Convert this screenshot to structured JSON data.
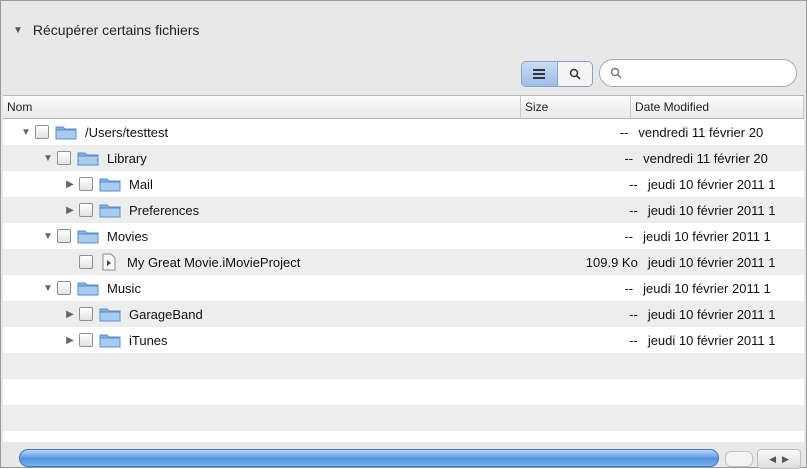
{
  "panel": {
    "title": "Récupérer certains fichiers",
    "title_icon": "disclosure-triangle-down-icon"
  },
  "toolbar": {
    "view_list_icon": "list-view-icon",
    "view_search_icon": "magnifier-icon",
    "search_placeholder": "",
    "search_icon": "magnifier-icon"
  },
  "table": {
    "columns": [
      "Nom",
      "Size",
      "Date Modified"
    ],
    "rows": [
      {
        "name": "/Users/testtest",
        "size": "--",
        "date": "vendredi 11 février 20",
        "level": 0,
        "disclosure": "open",
        "kind": "folder"
      },
      {
        "name": "Library",
        "size": "--",
        "date": "vendredi 11 février 20",
        "level": 1,
        "disclosure": "open",
        "kind": "folder"
      },
      {
        "name": "Mail",
        "size": "--",
        "date": "jeudi 10 février 2011 1",
        "level": 2,
        "disclosure": "closed",
        "kind": "folder"
      },
      {
        "name": "Preferences",
        "size": "--",
        "date": "jeudi 10 février 2011 1",
        "level": 2,
        "disclosure": "closed",
        "kind": "folder"
      },
      {
        "name": "Movies",
        "size": "--",
        "date": "jeudi 10 février 2011 1",
        "level": 1,
        "disclosure": "open",
        "kind": "folder"
      },
      {
        "name": "My Great Movie.iMovieProject",
        "size": "109.9 Ko",
        "date": "jeudi 10 février 2011 1",
        "level": 2,
        "disclosure": "none",
        "kind": "file"
      },
      {
        "name": "Music",
        "size": "--",
        "date": "jeudi 10 février 2011 1",
        "level": 1,
        "disclosure": "open",
        "kind": "folder"
      },
      {
        "name": "GarageBand",
        "size": "--",
        "date": "jeudi 10 février 2011 1",
        "level": 2,
        "disclosure": "closed",
        "kind": "folder"
      },
      {
        "name": "iTunes",
        "size": "--",
        "date": "jeudi 10 février 2011 1",
        "level": 2,
        "disclosure": "closed",
        "kind": "folder"
      }
    ]
  },
  "colors": {
    "folder_blue": "#7fb2e5",
    "scroll_blue": "#4f93e0",
    "alt_row": "#ededed"
  }
}
